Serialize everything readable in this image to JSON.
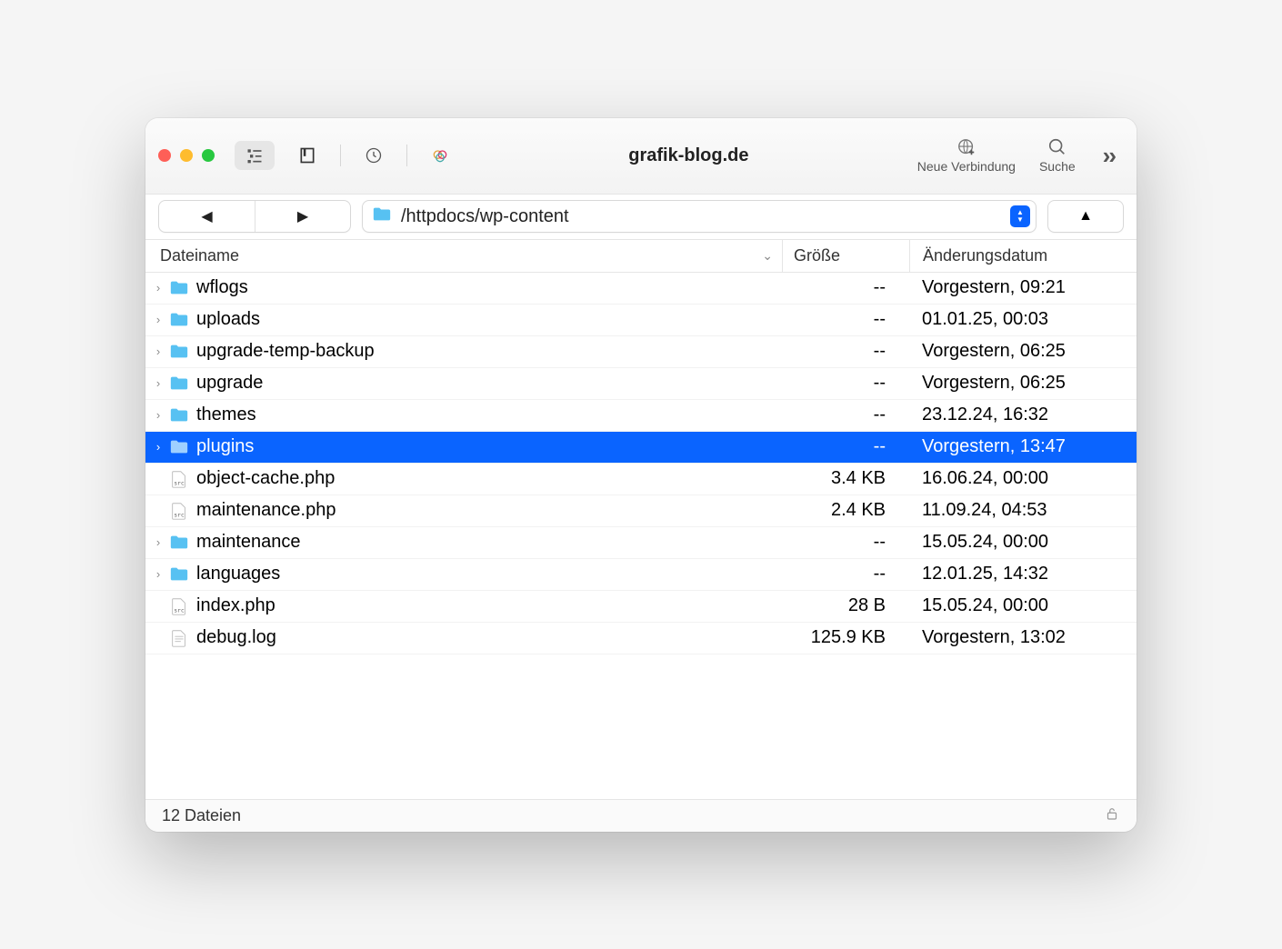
{
  "window": {
    "title": "grafik-blog.de"
  },
  "toolbar": {
    "new_connection_label": "Neue Verbindung",
    "search_label": "Suche"
  },
  "path": "/httpdocs/wp-content",
  "columns": {
    "name": "Dateiname",
    "size": "Größe",
    "date": "Änderungsdatum"
  },
  "files": [
    {
      "name": "wflogs",
      "type": "folder",
      "size": "--",
      "date": "Vorgestern, 09:21",
      "selected": false
    },
    {
      "name": "uploads",
      "type": "folder",
      "size": "--",
      "date": "01.01.25, 00:03",
      "selected": false
    },
    {
      "name": "upgrade-temp-backup",
      "type": "folder",
      "size": "--",
      "date": "Vorgestern, 06:25",
      "selected": false
    },
    {
      "name": "upgrade",
      "type": "folder",
      "size": "--",
      "date": "Vorgestern, 06:25",
      "selected": false
    },
    {
      "name": "themes",
      "type": "folder",
      "size": "--",
      "date": "23.12.24, 16:32",
      "selected": false
    },
    {
      "name": "plugins",
      "type": "folder",
      "size": "--",
      "date": "Vorgestern, 13:47",
      "selected": true
    },
    {
      "name": "object-cache.php",
      "type": "src",
      "size": "3.4 KB",
      "date": "16.06.24, 00:00",
      "selected": false
    },
    {
      "name": "maintenance.php",
      "type": "src",
      "size": "2.4 KB",
      "date": "11.09.24, 04:53",
      "selected": false
    },
    {
      "name": "maintenance",
      "type": "folder",
      "size": "--",
      "date": "15.05.24, 00:00",
      "selected": false
    },
    {
      "name": "languages",
      "type": "folder",
      "size": "--",
      "date": "12.01.25, 14:32",
      "selected": false
    },
    {
      "name": "index.php",
      "type": "src",
      "size": "28 B",
      "date": "15.05.24, 00:00",
      "selected": false
    },
    {
      "name": "debug.log",
      "type": "txt",
      "size": "125.9 KB",
      "date": "Vorgestern, 13:02",
      "selected": false
    }
  ],
  "status": "12 Dateien"
}
